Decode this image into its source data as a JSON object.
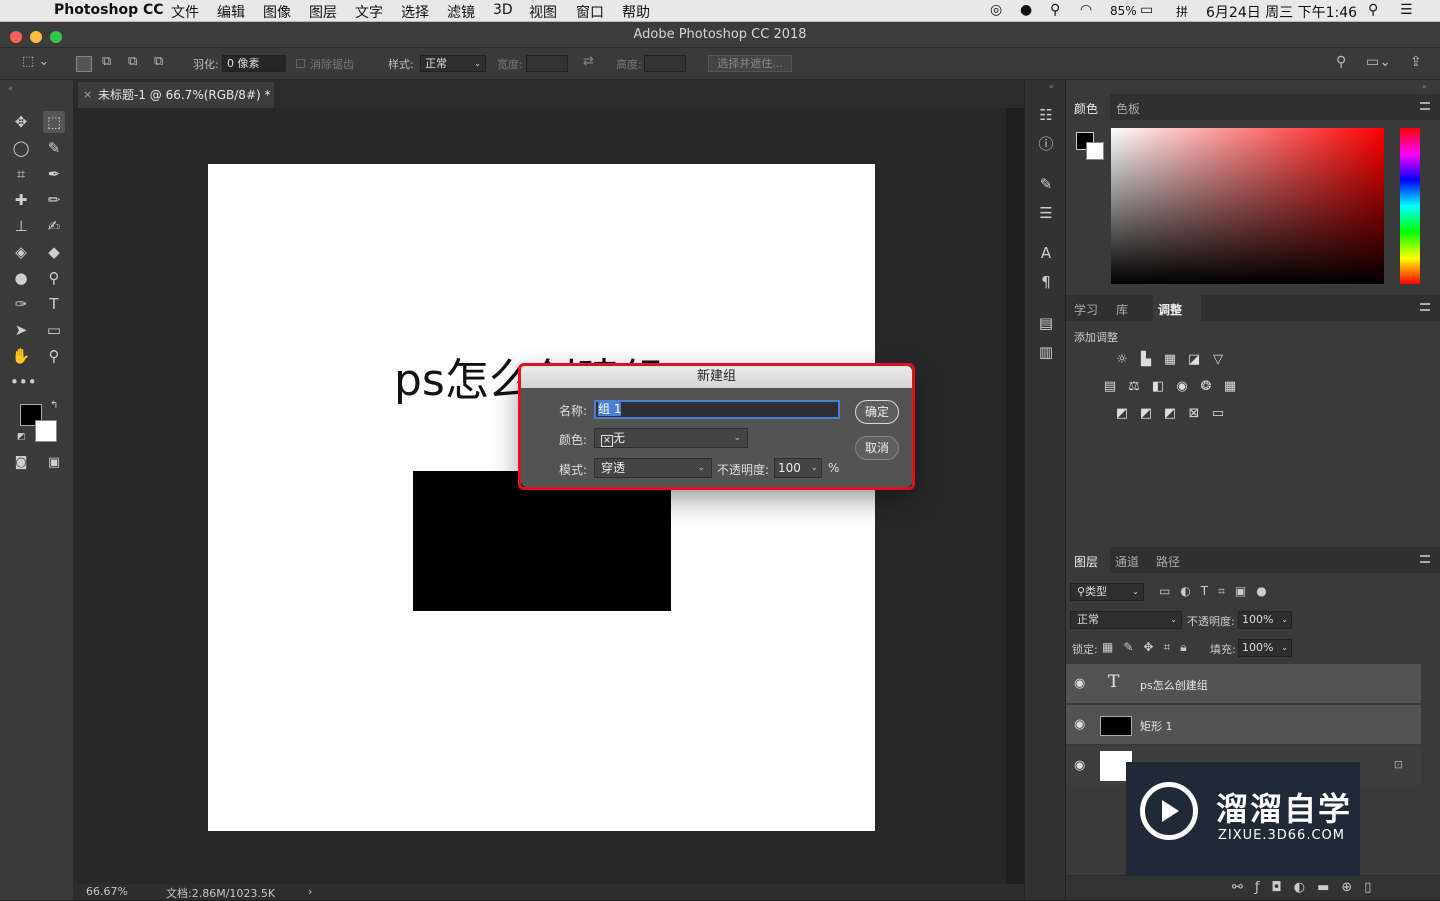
{
  "menubar": {
    "app": "Photoshop CC",
    "items": [
      "文件",
      "编辑",
      "图像",
      "图层",
      "文字",
      "选择",
      "滤镜",
      "3D",
      "视图",
      "窗口",
      "帮助"
    ],
    "battery": "85%",
    "datetime": "6月24日 周三 下午1:46"
  },
  "window": {
    "title": "Adobe Photoshop CC 2018"
  },
  "options": {
    "feather_label": "羽化:",
    "feather_value": "0 像素",
    "antialias_label": "消除锯齿",
    "style_label": "样式:",
    "style_value": "正常",
    "width_label": "宽度:",
    "height_label": "高度:",
    "select_mask_btn": "选择并遮住..."
  },
  "document": {
    "tab_title": "未标题-1 @ 66.7%(RGB/8#) *",
    "canvas_text": "ps怎么创建组",
    "zoom": "66.67%",
    "doc_size": "文档:2.86M/1023.5K"
  },
  "color_panel": {
    "tabs": [
      "颜色",
      "色板"
    ]
  },
  "adjust_panel": {
    "tabs": [
      "学习",
      "库",
      "调整"
    ],
    "add_label": "添加调整"
  },
  "layers_panel": {
    "tabs": [
      "图层",
      "通道",
      "路径"
    ],
    "filter_label": "类型",
    "blend_mode": "正常",
    "opacity_label": "不透明度:",
    "opacity_value": "100%",
    "lock_label": "锁定:",
    "fill_label": "填充:",
    "fill_value": "100%",
    "layers": [
      {
        "name": "ps怎么创建组",
        "type": "text"
      },
      {
        "name": "矩形 1",
        "type": "shape"
      },
      {
        "name": "",
        "type": "background"
      }
    ]
  },
  "dialog": {
    "title": "新建组",
    "name_label": "名称:",
    "name_value": "组 1",
    "color_label": "颜色:",
    "color_value": "无",
    "mode_label": "模式:",
    "mode_value": "穿透",
    "opacity_label": "不透明度:",
    "opacity_value": "100",
    "percent": "%",
    "ok_label": "确定",
    "cancel_label": "取消"
  },
  "watermark": {
    "title": "溜溜自学",
    "url": "ZIXUE.3D66.COM"
  },
  "colors": {
    "accent_red": "#e0101c",
    "panel": "#3a3a3a",
    "canvas": "#ffffff"
  }
}
